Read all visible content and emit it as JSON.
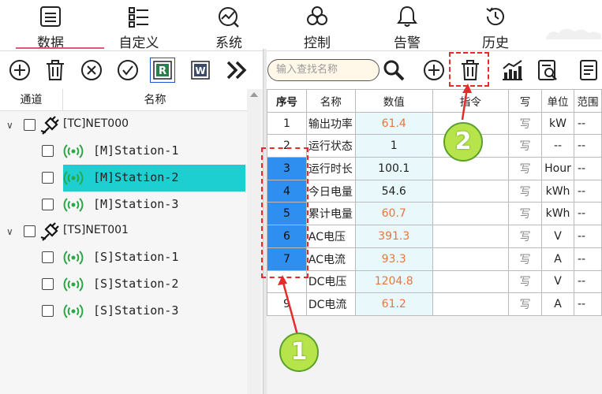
{
  "nav": {
    "tabs": [
      {
        "label": "数据",
        "icon": "data-list-icon",
        "active": true
      },
      {
        "label": "自定义",
        "icon": "custom-grid-icon",
        "active": false
      },
      {
        "label": "系统",
        "icon": "system-gauge-icon",
        "active": false
      },
      {
        "label": "控制",
        "icon": "control-spiral-icon",
        "active": false
      },
      {
        "label": "告警",
        "icon": "alarm-bell-icon",
        "active": false
      },
      {
        "label": "历史",
        "icon": "history-clock-icon",
        "active": false
      }
    ],
    "active_color": "#e0567a"
  },
  "left_toolbar": {
    "buttons": [
      "add-icon",
      "delete-icon",
      "cancel-icon",
      "confirm-icon",
      "r-report-icon",
      "w-word-icon",
      "more-icon"
    ]
  },
  "tree": {
    "col_channel": "通道",
    "col_name": "名称",
    "items": [
      {
        "level": 0,
        "label": "[TC]NET000",
        "type": "net"
      },
      {
        "level": 1,
        "label": "[M]Station-1",
        "type": "station"
      },
      {
        "level": 1,
        "label": "[M]Station-2",
        "type": "station",
        "selected": true
      },
      {
        "level": 1,
        "label": "[M]Station-3",
        "type": "station"
      },
      {
        "level": 0,
        "label": "[TS]NET001",
        "type": "net"
      },
      {
        "level": 1,
        "label": "[S]Station-1",
        "type": "station"
      },
      {
        "level": 1,
        "label": "[S]Station-2",
        "type": "station"
      },
      {
        "level": 1,
        "label": "[S]Station-3",
        "type": "station"
      }
    ],
    "selected_color": "#1ecfd2"
  },
  "right_toolbar": {
    "search_placeholder": "输入查找名称"
  },
  "grid": {
    "headers": [
      "序号",
      "名称",
      "数值",
      "指令",
      "写",
      "单位",
      "范围"
    ],
    "rows": [
      {
        "seq": "1",
        "name": "输出功率",
        "value": "61.4",
        "orange": true,
        "write": "写",
        "unit": "kW",
        "range": "--",
        "selected": false
      },
      {
        "seq": "2",
        "name": "运行状态",
        "value": "1",
        "orange": false,
        "write": "写",
        "unit": "--",
        "range": "--",
        "selected": false
      },
      {
        "seq": "3",
        "name": "运行时长",
        "value": "100.1",
        "orange": false,
        "write": "写",
        "unit": "Hour",
        "range": "--",
        "selected": true
      },
      {
        "seq": "4",
        "name": "今日电量",
        "value": "54.6",
        "orange": false,
        "write": "写",
        "unit": "kWh",
        "range": "--",
        "selected": true
      },
      {
        "seq": "5",
        "name": "累计电量",
        "value": "60.7",
        "orange": true,
        "write": "写",
        "unit": "kWh",
        "range": "--",
        "selected": true
      },
      {
        "seq": "6",
        "name": "AC电压",
        "value": "391.3",
        "orange": true,
        "write": "写",
        "unit": "V",
        "range": "--",
        "selected": true
      },
      {
        "seq": "7",
        "name": "AC电流",
        "value": "93.3",
        "orange": true,
        "write": "写",
        "unit": "A",
        "range": "--",
        "selected": true
      },
      {
        "seq": "",
        "name": "DC电压",
        "value": "1204.8",
        "orange": true,
        "write": "写",
        "unit": "V",
        "range": "--",
        "selected": false
      },
      {
        "seq": "9",
        "name": "DC电流",
        "value": "61.2",
        "orange": true,
        "write": "写",
        "unit": "A",
        "range": "--",
        "selected": false
      }
    ],
    "selected_color": "#2e8ff0",
    "value_color": "#e9763b"
  },
  "annotations": {
    "badge1": "1",
    "badge2": "2",
    "color": "#e52b2b",
    "badge_color": "#b7e44a"
  }
}
